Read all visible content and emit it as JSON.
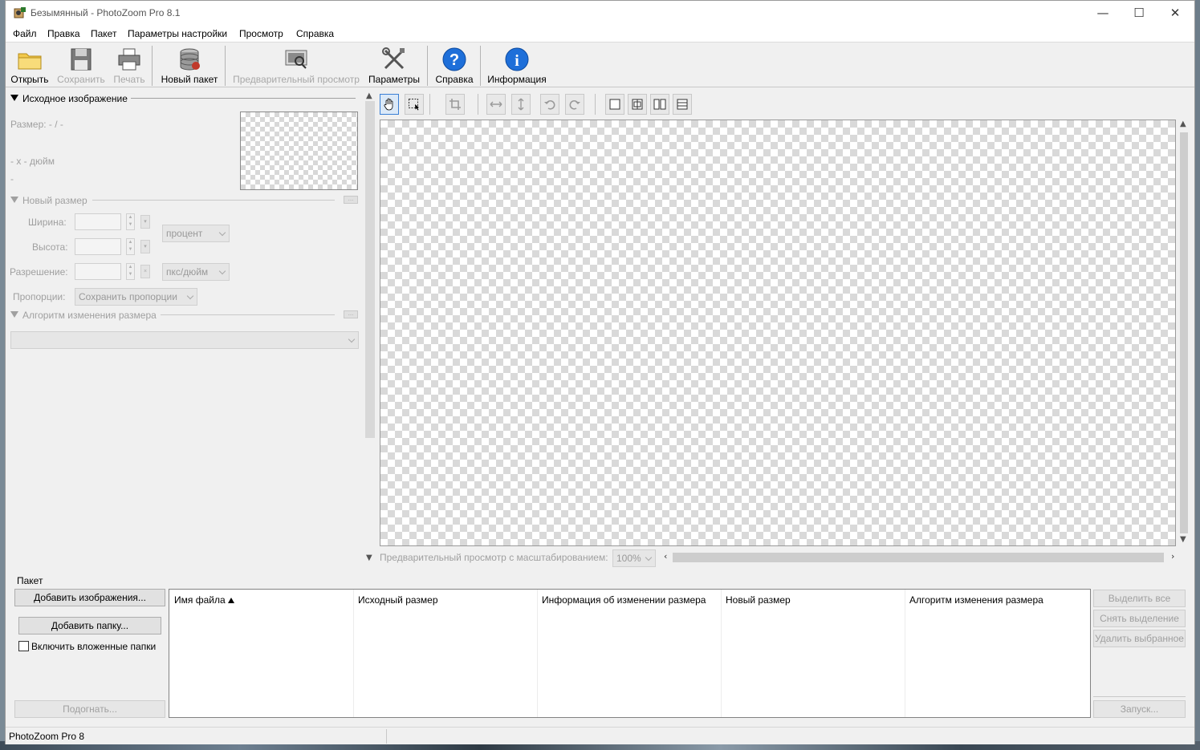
{
  "window": {
    "title": "Безымянный - PhotoZoom Pro 8.1",
    "minimize_glyph": "—",
    "maximize_glyph": "☐",
    "close_glyph": "✕"
  },
  "menu": {
    "items": [
      "Файл",
      "Правка",
      "Пакет",
      "Параметры настройки",
      "Просмотр",
      "Справка"
    ]
  },
  "toolbar": {
    "open": "Открыть",
    "save": "Сохранить",
    "print": "Печать",
    "new_batch": "Новый пакет",
    "preview": "Предварительный просмотр",
    "settings": "Параметры",
    "help": "Справка",
    "info": "Информация",
    "icons": {
      "open": "folder-icon",
      "save": "floppy-disk-icon",
      "print": "printer-icon",
      "new_batch": "database-stack-icon",
      "preview": "preview-icon",
      "settings": "tools-icon",
      "help": "question-icon",
      "info": "info-icon"
    }
  },
  "source_image": {
    "header": "Исходное изображение",
    "size_label": "Размер: - / -",
    "dpi_label": "- x - дюйм",
    "extra": "-"
  },
  "new_size": {
    "header": "Новый размер",
    "width_label": "Ширина:",
    "height_label": "Высота:",
    "resolution_label": "Разрешение:",
    "proportions_label": "Пропорции:",
    "unit_value": "процент",
    "resolution_unit_value": "пкс/дюйм",
    "proportions_value": "Сохранить пропорции"
  },
  "algorithm": {
    "header": "Алгоритм изменения размера",
    "value": ""
  },
  "preview": {
    "zoom_label": "Предварительный просмотр с масштабированием:",
    "zoom_value": "100%"
  },
  "batch": {
    "label": "Пакет",
    "add_images": "Добавить изображения...",
    "add_folder": "Добавить папку...",
    "include_subfolders": "Включить вложенные папки",
    "fit": "Подогнать...",
    "columns": [
      "Имя файла",
      "Исходный размер",
      "Информация об изменении размера",
      "Новый размер",
      "Алгоритм изменения размера"
    ],
    "select_all": "Выделить все",
    "deselect": "Снять выделение",
    "remove_selected": "Удалить выбранное",
    "run": "Запуск..."
  },
  "status": {
    "text": "PhotoZoom Pro 8"
  },
  "colors": {
    "accent": "#3a7fd5",
    "help_blue": "#1e6fd9",
    "disabled_text": "#a0a0a0"
  }
}
